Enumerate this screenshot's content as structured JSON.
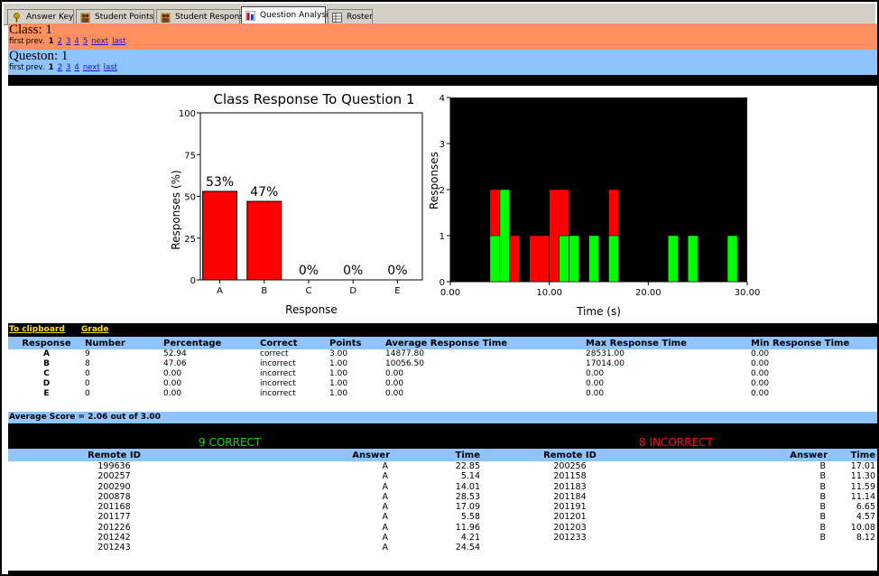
{
  "tabs": [
    {
      "label": "Answer Key",
      "icon": "key-icon",
      "active": false
    },
    {
      "label": "Student Points",
      "icon": "students-icon",
      "active": false
    },
    {
      "label": "Student Responses",
      "icon": "students-icon",
      "active": false
    },
    {
      "label": "Question Analysis",
      "icon": "bar-chart-icon",
      "active": true
    },
    {
      "label": "Roster",
      "icon": "roster-icon",
      "active": false
    }
  ],
  "class_section": {
    "title": "Class: 1",
    "pager": {
      "first": "first",
      "prev": "prev.",
      "current": "1",
      "pages": [
        "2",
        "3",
        "4",
        "5"
      ],
      "next": "next",
      "last": "last"
    }
  },
  "question_section": {
    "title": "Queston: 1",
    "pager": {
      "first": "first",
      "prev": "prev.",
      "current": "1",
      "pages": [
        "2",
        "3",
        "4"
      ],
      "next": "next",
      "last": "last"
    }
  },
  "colors": {
    "class_bar": "#ff9060",
    "question_bar": "#8fc4ff",
    "correct": "#00e000",
    "incorrect": "#ff1010",
    "link": "#ffe000"
  },
  "chart_data": [
    {
      "type": "bar",
      "title": "Class Response To Question 1",
      "xlabel": "Response",
      "ylabel": "Responses (%)",
      "categories": [
        "A",
        "B",
        "C",
        "D",
        "E"
      ],
      "values": [
        53,
        47,
        0,
        0,
        0
      ],
      "data_labels": [
        "53%",
        "47%",
        "0%",
        "0%",
        "0%"
      ],
      "ylim": [
        0,
        100
      ],
      "yticks": [
        "0",
        "25",
        "50",
        "75",
        "100"
      ],
      "bar_color": "#ff0000"
    },
    {
      "type": "bar",
      "title": "",
      "xlabel": "Time (s)",
      "ylabel": "Responses",
      "xlim": [
        0,
        30
      ],
      "ylim": [
        0,
        4
      ],
      "xticks": [
        "0.00",
        "10.00",
        "20.00",
        "30.00"
      ],
      "yticks": [
        "0",
        "1",
        "2",
        "3",
        "4"
      ],
      "background": "#000000",
      "bin_width": 1,
      "series": [
        {
          "name": "correct",
          "color": "#00ff00",
          "bins": [
            {
              "x": 4,
              "count": 1
            },
            {
              "x": 5,
              "count": 2
            },
            {
              "x": 11,
              "count": 1
            },
            {
              "x": 12,
              "count": 1
            },
            {
              "x": 14,
              "count": 1
            },
            {
              "x": 16,
              "count": 1
            },
            {
              "x": 22,
              "count": 1
            },
            {
              "x": 24,
              "count": 1
            },
            {
              "x": 28,
              "count": 1
            }
          ]
        },
        {
          "name": "incorrect",
          "color": "#ff0000",
          "bins": [
            {
              "x": 4,
              "count": 1
            },
            {
              "x": 6,
              "count": 1
            },
            {
              "x": 8,
              "count": 1
            },
            {
              "x": 9,
              "count": 1
            },
            {
              "x": 10,
              "count": 2
            },
            {
              "x": 11,
              "count": 1
            },
            {
              "x": 16,
              "count": 1
            }
          ]
        }
      ]
    }
  ],
  "links": {
    "clipboard": "To clipboard",
    "grade": "Grade"
  },
  "response_table": {
    "headers": [
      "Response",
      "Number",
      "Percentage",
      "Correct",
      "Points",
      "Average Response Time",
      "Max Response Time",
      "Min Response Time"
    ],
    "rows": [
      [
        "A",
        "9",
        "52.94",
        "correct",
        "3.00",
        "14877.80",
        "28531.00",
        "0.00"
      ],
      [
        "B",
        "8",
        "47.06",
        "incorrect",
        "1.00",
        "10056.50",
        "17014.00",
        "0.00"
      ],
      [
        "C",
        "0",
        "0.00",
        "incorrect",
        "1.00",
        "0.00",
        "0.00",
        "0.00"
      ],
      [
        "D",
        "0",
        "0.00",
        "incorrect",
        "1.00",
        "0.00",
        "0.00",
        "0.00"
      ],
      [
        "E",
        "0",
        "0.00",
        "incorrect",
        "1.00",
        "0.00",
        "0.00",
        "0.00"
      ]
    ]
  },
  "average_score": "Average Score = 2.06 out of 3.00",
  "correct_title": "9 CORRECT",
  "incorrect_title": "8 INCORRECT",
  "ids_table": {
    "headers": [
      "Remote ID",
      "Answer",
      "Time",
      "Remote ID",
      "Answer",
      "Time"
    ],
    "correct_rows": [
      [
        "199636",
        "A",
        "22.85"
      ],
      [
        "200257",
        "A",
        "5.14"
      ],
      [
        "200290",
        "A",
        "14.01"
      ],
      [
        "200878",
        "A",
        "28.53"
      ],
      [
        "201168",
        "A",
        "17.09"
      ],
      [
        "201177",
        "A",
        "5.58"
      ],
      [
        "201226",
        "A",
        "11.96"
      ],
      [
        "201242",
        "A",
        "4.21"
      ],
      [
        "201243",
        "A",
        "24.54"
      ]
    ],
    "incorrect_rows": [
      [
        "200256",
        "B",
        "17.01"
      ],
      [
        "201158",
        "B",
        "11.30"
      ],
      [
        "201183",
        "B",
        "11.59"
      ],
      [
        "201184",
        "B",
        "11.14"
      ],
      [
        "201191",
        "B",
        "6.65"
      ],
      [
        "201201",
        "B",
        "4.57"
      ],
      [
        "201203",
        "B",
        "10.08"
      ],
      [
        "201233",
        "B",
        "8.12"
      ]
    ]
  }
}
